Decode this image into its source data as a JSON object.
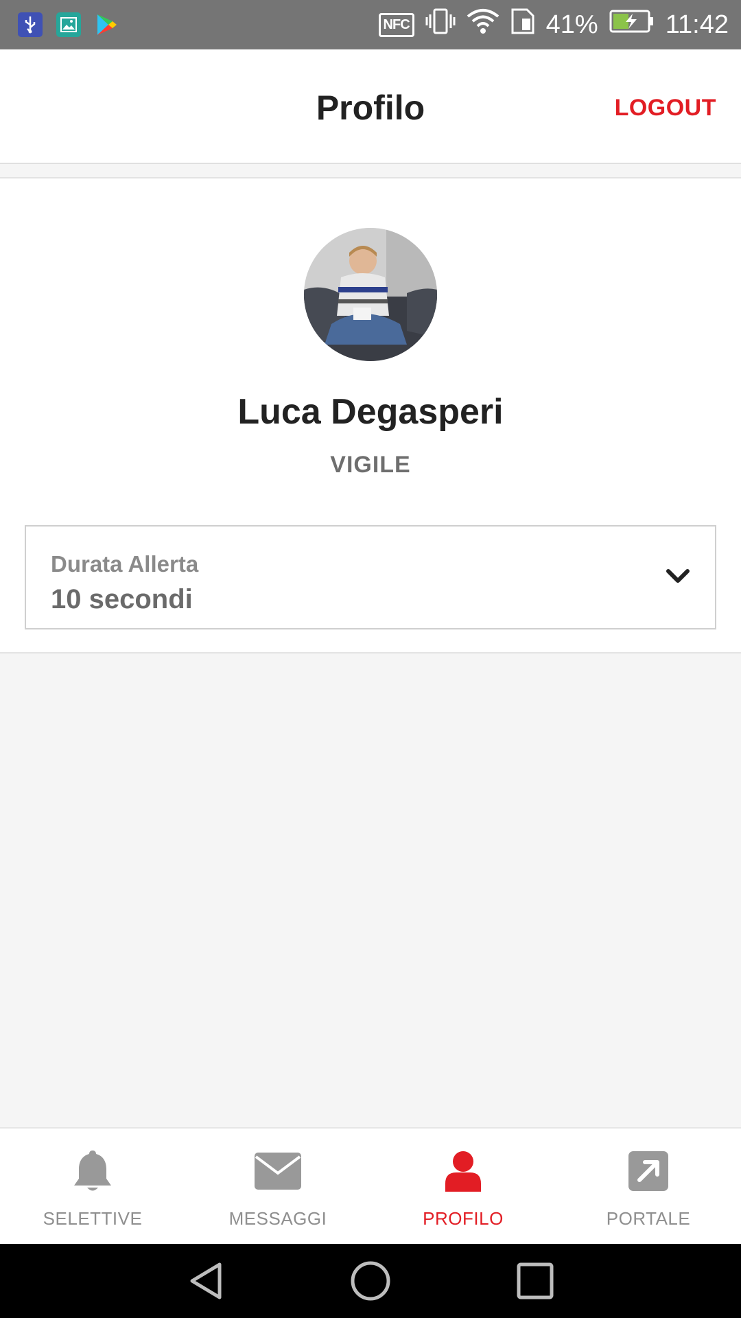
{
  "status_bar": {
    "nfc_label": "NFC",
    "battery_percent": "41%",
    "time": "11:42"
  },
  "header": {
    "title": "Profilo",
    "logout_label": "LOGOUT"
  },
  "profile": {
    "name": "Luca Degasperi",
    "role": "VIGILE"
  },
  "alert_duration": {
    "label": "Durata Allerta",
    "value": "10 secondi"
  },
  "bottom_nav": {
    "items": [
      {
        "label": "SELETTIVE",
        "icon": "bell-icon"
      },
      {
        "label": "MESSAGGI",
        "icon": "envelope-icon"
      },
      {
        "label": "PROFILO",
        "icon": "user-icon"
      },
      {
        "label": "PORTALE",
        "icon": "external-link-icon"
      }
    ],
    "active_index": 2
  },
  "colors": {
    "accent_red": "#e21d24",
    "indicator_yellow": "#f7e11b",
    "inactive_gray": "#8f8f8f"
  }
}
